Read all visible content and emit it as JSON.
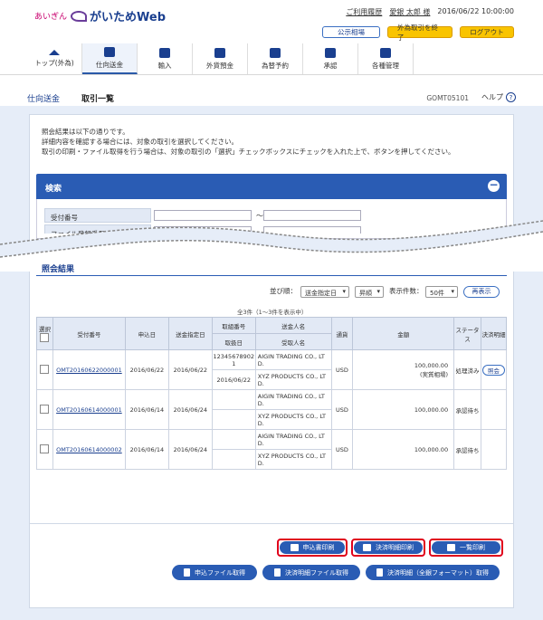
{
  "header": {
    "bank": "あいぎん",
    "app": "がいためWeb",
    "links": [
      "ご利用履歴",
      "愛銀 太郎 様",
      "2016/06/22 10:00:00"
    ],
    "buttons": {
      "rate": "公示相場",
      "end_fx": "外為取引を終了",
      "logout": "ログアウト"
    }
  },
  "nav": [
    {
      "label": "トップ(外為)"
    },
    {
      "label": "仕向送金"
    },
    {
      "label": "輸入"
    },
    {
      "label": "外貨預金"
    },
    {
      "label": "為替予約"
    },
    {
      "label": "承認"
    },
    {
      "label": "各種管理"
    }
  ],
  "sub": {
    "section": "仕向送金",
    "page": "取引一覧",
    "code": "GOMT05101",
    "help": "ヘルプ"
  },
  "intro": [
    "照会結果は以下の通りです。",
    "詳細内容を確認する場合には、対象の取引を選択してください。",
    "取引の印刷・ファイル取得を行う場合は、対象の取引の「選択」チェックボックスにチェックを入れた上で、ボタンを押してください。"
  ],
  "search": {
    "title": "検索",
    "f1": "受付番号",
    "f2": "ファイル登録番号",
    "tilde": "～"
  },
  "results": {
    "title": "照会結果",
    "sort_label": "並び順：",
    "sort_value": "送金指定日",
    "order": "昇順",
    "per_label": "表示件数：",
    "per_value": "50件",
    "redisplay": "再表示",
    "count": "全3件（1～3件を表示中）"
  },
  "table": {
    "h": {
      "select": "選択",
      "ref": "受付番号",
      "apply": "申込日",
      "designated": "送金指定日",
      "trade_no": "取組番号",
      "trade_date": "取扱日",
      "remitter": "送金人名",
      "payee": "受取人名",
      "ccy": "通貨",
      "amount": "金額",
      "status": "ステータス",
      "detail": "決済明細"
    },
    "rows": [
      {
        "ref": "OMT20160622000001",
        "apply": "2016/06/22",
        "designated": "2016/06/22",
        "trade_no": "12345678902 1",
        "trade_date": "2016/06/22",
        "remitter": "AIGIN TRADING CO., LT D.",
        "payee": "XYZ PRODUCTS CO., LT D.",
        "ccy": "USD",
        "amount": "100,000.00",
        "amount_sub": "(実質相場)",
        "status": "処理済み",
        "detail": "照会"
      },
      {
        "ref": "OMT20160614000001",
        "apply": "2016/06/14",
        "designated": "2016/06/24",
        "trade_no": "",
        "trade_date": "",
        "remitter": "AIGIN TRADING CO., LT D.",
        "payee": "XYZ PRODUCTS CO., LT D.",
        "ccy": "USD",
        "amount": "100,000.00",
        "amount_sub": "",
        "status": "承認待ち",
        "detail": ""
      },
      {
        "ref": "OMT20160614000002",
        "apply": "2016/06/14",
        "designated": "2016/06/24",
        "trade_no": "",
        "trade_date": "",
        "remitter": "AIGIN TRADING CO., LT D.",
        "payee": "XYZ PRODUCTS CO., LT D.",
        "ccy": "USD",
        "amount": "100,000.00",
        "amount_sub": "",
        "status": "承認待ち",
        "detail": ""
      }
    ]
  },
  "actions": {
    "print_app": "申込書印刷",
    "print_settle": "決済明細印刷",
    "print_list": "一覧印刷",
    "file_app": "申込ファイル取得",
    "file_settle": "決済明細ファイル取得",
    "file_settle_all": "決済明細（全銀フォーマット）取得"
  }
}
